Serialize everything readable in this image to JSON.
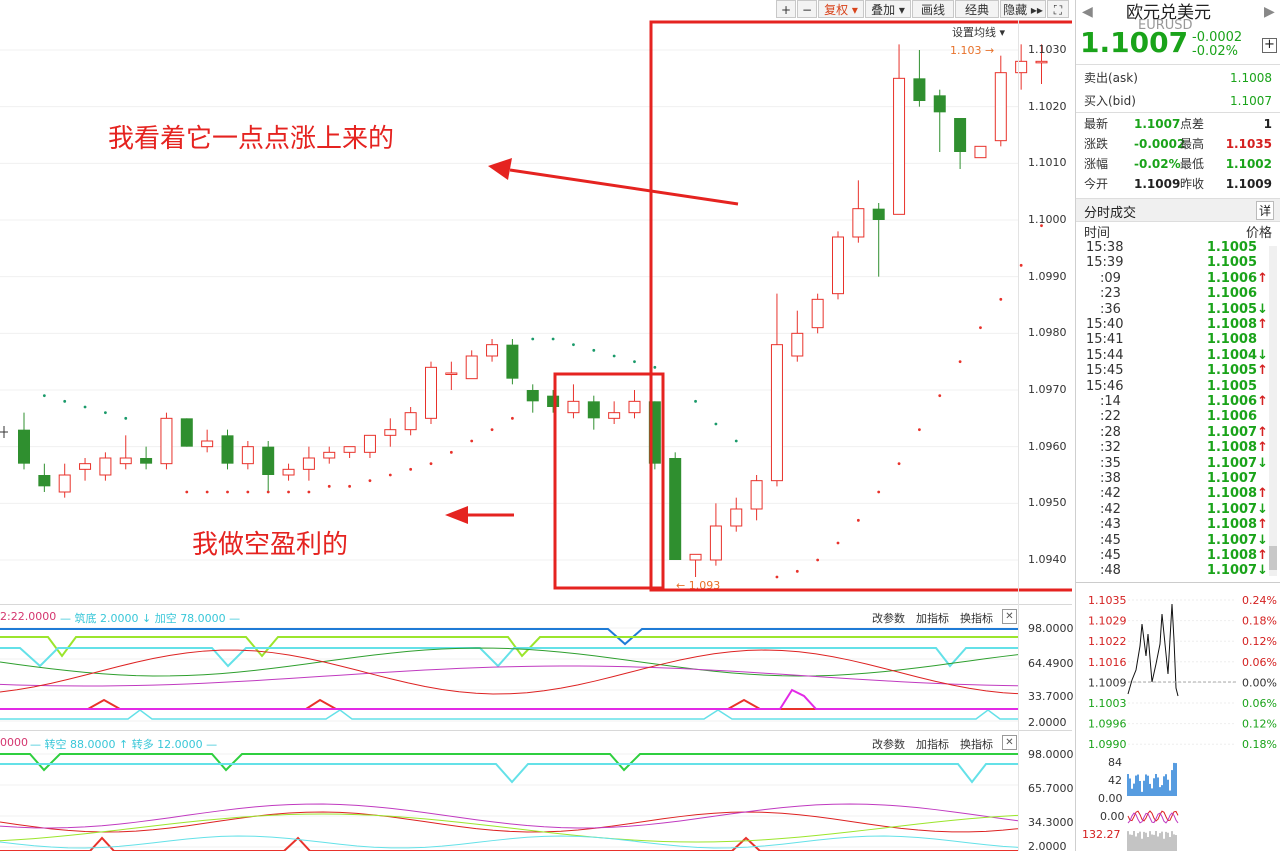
{
  "toolbar": {
    "plus": "+",
    "minus": "−",
    "fuquan": "复权 ▾",
    "diejia": "叠加 ▾",
    "huaxian": "画线",
    "jingdian": "经典",
    "yincang": "隐藏 ▸▸",
    "expand": "⛶"
  },
  "chart": {
    "ma_setting": "设置均线 ▾",
    "price_labels": [
      "1.1030",
      "1.1020",
      "1.1010",
      "1.1000",
      "1.0990",
      "1.0980",
      "1.0970",
      "1.0960",
      "1.0950",
      "1.0940"
    ],
    "high_marker": "1.103",
    "low_marker": "1.093"
  },
  "annotations": {
    "top": "我看着它一点点涨上来的",
    "bottom": "我做空盈利的"
  },
  "indicator1": {
    "header_left": "2:22.0000",
    "header_mid": "— 筑底 2.0000 ↓ 加空 78.0000 —",
    "scale": [
      "98.0000",
      "64.4900",
      "33.7000",
      "2.0000"
    ],
    "btn_params": "改参数",
    "btn_add": "加指标",
    "btn_switch": "换指标",
    "btn_close": "✕"
  },
  "indicator2": {
    "header_left": "0000",
    "header_mid": "— 转空 88.0000 ↑ 转多 12.0000 —",
    "scale": [
      "98.0000",
      "65.7000",
      "34.3000",
      "2.0000"
    ],
    "btn_params": "改参数",
    "btn_add": "加指标",
    "btn_switch": "换指标",
    "btn_close": "✕"
  },
  "quote": {
    "name": "欧元兑美元",
    "code": "EURUSD",
    "last": "1.1007",
    "change": "-0.0002",
    "change_pct": "-0.02%",
    "ask_label": "卖出(ask)",
    "ask": "1.1008",
    "bid_label": "买入(bid)",
    "bid": "1.1007",
    "stats": [
      {
        "l1": "最新",
        "v1": "1.1007",
        "c1": "grn",
        "l2": "点差",
        "v2": "1",
        "c2": "blk"
      },
      {
        "l1": "涨跌",
        "v1": "-0.0002",
        "c1": "grn",
        "l2": "最高",
        "v2": "1.1035",
        "c2": "red"
      },
      {
        "l1": "涨幅",
        "v1": "-0.02%",
        "c1": "grn",
        "l2": "最低",
        "v2": "1.1002",
        "c2": "grn"
      },
      {
        "l1": "今开",
        "v1": "1.1009",
        "c1": "blk",
        "l2": "昨收",
        "v2": "1.1009",
        "c2": "blk"
      }
    ]
  },
  "trades": {
    "title": "分时成交",
    "detail": "详",
    "col_time": "时间",
    "col_price": "价格",
    "rows": [
      {
        "t": "15:38",
        "p": "1.1005",
        "d": ""
      },
      {
        "t": "15:39",
        "p": "1.1005",
        "d": ""
      },
      {
        "t": ":09",
        "p": "1.1006",
        "d": "↑"
      },
      {
        "t": ":23",
        "p": "1.1006",
        "d": ""
      },
      {
        "t": ":36",
        "p": "1.1005",
        "d": "↓"
      },
      {
        "t": "15:40",
        "p": "1.1008",
        "d": "↑"
      },
      {
        "t": "15:41",
        "p": "1.1008",
        "d": ""
      },
      {
        "t": "15:44",
        "p": "1.1004",
        "d": "↓"
      },
      {
        "t": "15:45",
        "p": "1.1005",
        "d": "↑"
      },
      {
        "t": "15:46",
        "p": "1.1005",
        "d": ""
      },
      {
        "t": ":14",
        "p": "1.1006",
        "d": "↑"
      },
      {
        "t": ":22",
        "p": "1.1006",
        "d": ""
      },
      {
        "t": ":28",
        "p": "1.1007",
        "d": "↑"
      },
      {
        "t": ":32",
        "p": "1.1008",
        "d": "↑"
      },
      {
        "t": ":35",
        "p": "1.1007",
        "d": "↓"
      },
      {
        "t": ":38",
        "p": "1.1007",
        "d": ""
      },
      {
        "t": ":42",
        "p": "1.1008",
        "d": "↑"
      },
      {
        "t": ":42",
        "p": "1.1007",
        "d": "↓"
      },
      {
        "t": ":43",
        "p": "1.1008",
        "d": "↑"
      },
      {
        "t": ":45",
        "p": "1.1007",
        "d": "↓"
      },
      {
        "t": ":45",
        "p": "1.1008",
        "d": "↑"
      },
      {
        "t": ":48",
        "p": "1.1007",
        "d": "↓"
      }
    ]
  },
  "mini": {
    "price_left": [
      "1.1035",
      "1.1029",
      "1.1022",
      "1.1016",
      "1.1009",
      "1.1003",
      "1.0996",
      "1.0990"
    ],
    "pct_right": [
      "0.24%",
      "0.18%",
      "0.12%",
      "0.06%",
      "0.00%",
      "0.06%",
      "0.12%",
      "0.18%"
    ],
    "vol_labels": [
      "84",
      "42",
      "0.00"
    ],
    "ind_labels": [
      "0.00",
      "132.27"
    ]
  },
  "colors": {
    "up": "#e8322b",
    "down": "#2f8f2f",
    "box": "#e52320",
    "sar": "#e8322b"
  },
  "candles": [
    {
      "o": 1.0963,
      "h": 1.0966,
      "l": 1.0956,
      "c": 1.0957
    },
    {
      "o": 1.0955,
      "h": 1.0957,
      "l": 1.0952,
      "c": 1.0953
    },
    {
      "o": 1.0952,
      "h": 1.0957,
      "l": 1.0951,
      "c": 1.0955
    },
    {
      "o": 1.0956,
      "h": 1.0958,
      "l": 1.0954,
      "c": 1.0957
    },
    {
      "o": 1.0955,
      "h": 1.0959,
      "l": 1.0954,
      "c": 1.0958
    },
    {
      "o": 1.0957,
      "h": 1.0962,
      "l": 1.0956,
      "c": 1.0958
    },
    {
      "o": 1.0958,
      "h": 1.096,
      "l": 1.0956,
      "c": 1.0957
    },
    {
      "o": 1.0957,
      "h": 1.0966,
      "l": 1.0956,
      "c": 1.0965
    },
    {
      "o": 1.0965,
      "h": 1.0965,
      "l": 1.096,
      "c": 1.096
    },
    {
      "o": 1.096,
      "h": 1.0963,
      "l": 1.0959,
      "c": 1.0961
    },
    {
      "o": 1.0962,
      "h": 1.0963,
      "l": 1.0956,
      "c": 1.0957
    },
    {
      "o": 1.0957,
      "h": 1.0961,
      "l": 1.0956,
      "c": 1.096
    },
    {
      "o": 1.096,
      "h": 1.0961,
      "l": 1.0952,
      "c": 1.0955
    },
    {
      "o": 1.0955,
      "h": 1.0957,
      "l": 1.0954,
      "c": 1.0956
    },
    {
      "o": 1.0956,
      "h": 1.096,
      "l": 1.0954,
      "c": 1.0958
    },
    {
      "o": 1.0958,
      "h": 1.096,
      "l": 1.0957,
      "c": 1.0959
    },
    {
      "o": 1.0959,
      "h": 1.096,
      "l": 1.0958,
      "c": 1.096
    },
    {
      "o": 1.0959,
      "h": 1.0962,
      "l": 1.0958,
      "c": 1.0962
    },
    {
      "o": 1.0962,
      "h": 1.0965,
      "l": 1.096,
      "c": 1.0963
    },
    {
      "o": 1.0963,
      "h": 1.0967,
      "l": 1.0962,
      "c": 1.0966
    },
    {
      "o": 1.0965,
      "h": 1.0975,
      "l": 1.0964,
      "c": 1.0974
    },
    {
      "o": 1.0973,
      "h": 1.0975,
      "l": 1.097,
      "c": 1.0973
    },
    {
      "o": 1.0972,
      "h": 1.0977,
      "l": 1.0972,
      "c": 1.0976
    },
    {
      "o": 1.0976,
      "h": 1.0979,
      "l": 1.0975,
      "c": 1.0978
    },
    {
      "o": 1.0978,
      "h": 1.0979,
      "l": 1.0971,
      "c": 1.0972
    },
    {
      "o": 1.097,
      "h": 1.0971,
      "l": 1.0966,
      "c": 1.0968
    },
    {
      "o": 1.0969,
      "h": 1.097,
      "l": 1.0966,
      "c": 1.0967
    },
    {
      "o": 1.0966,
      "h": 1.0971,
      "l": 1.0965,
      "c": 1.0968
    },
    {
      "o": 1.0968,
      "h": 1.0969,
      "l": 1.0963,
      "c": 1.0965
    },
    {
      "o": 1.0965,
      "h": 1.0968,
      "l": 1.0964,
      "c": 1.0966
    },
    {
      "o": 1.0966,
      "h": 1.097,
      "l": 1.0965,
      "c": 1.0968
    },
    {
      "o": 1.0968,
      "h": 1.0968,
      "l": 1.0956,
      "c": 1.0957
    },
    {
      "o": 1.0958,
      "h": 1.0959,
      "l": 1.094,
      "c": 1.094
    },
    {
      "o": 1.094,
      "h": 1.0941,
      "l": 1.0937,
      "c": 1.0941
    },
    {
      "o": 1.094,
      "h": 1.095,
      "l": 1.0939,
      "c": 1.0946
    },
    {
      "o": 1.0946,
      "h": 1.0951,
      "l": 1.0945,
      "c": 1.0949
    },
    {
      "o": 1.0949,
      "h": 1.0955,
      "l": 1.0947,
      "c": 1.0954
    },
    {
      "o": 1.0954,
      "h": 1.0987,
      "l": 1.0953,
      "c": 1.0978
    },
    {
      "o": 1.0976,
      "h": 1.0984,
      "l": 1.0975,
      "c": 1.098
    },
    {
      "o": 1.0981,
      "h": 1.0987,
      "l": 1.098,
      "c": 1.0986
    },
    {
      "o": 1.0987,
      "h": 1.0998,
      "l": 1.0986,
      "c": 1.0997
    },
    {
      "o": 1.0997,
      "h": 1.1007,
      "l": 1.0996,
      "c": 1.1002
    },
    {
      "o": 1.1002,
      "h": 1.1003,
      "l": 1.099,
      "c": 1.1
    },
    {
      "o": 1.1001,
      "h": 1.1031,
      "l": 1.1001,
      "c": 1.1025
    },
    {
      "o": 1.1025,
      "h": 1.103,
      "l": 1.102,
      "c": 1.1021
    },
    {
      "o": 1.1022,
      "h": 1.1023,
      "l": 1.1012,
      "c": 1.1019
    },
    {
      "o": 1.1018,
      "h": 1.1018,
      "l": 1.1009,
      "c": 1.1012
    },
    {
      "o": 1.1011,
      "h": 1.1013,
      "l": 1.1011,
      "c": 1.1013
    },
    {
      "o": 1.1014,
      "h": 1.1029,
      "l": 1.1013,
      "c": 1.1026
    },
    {
      "o": 1.1026,
      "h": 1.1031,
      "l": 1.1023,
      "c": 1.1028
    },
    {
      "o": 1.1028,
      "h": 1.1031,
      "l": 1.1024,
      "c": 1.1028
    }
  ],
  "sar": [
    {
      "i": 1,
      "v": 1.0969
    },
    {
      "i": 2,
      "v": 1.0968
    },
    {
      "i": 3,
      "v": 1.0967
    },
    {
      "i": 4,
      "v": 1.0966
    },
    {
      "i": 5,
      "v": 1.0965
    },
    {
      "i": 8,
      "v": 1.0952
    },
    {
      "i": 9,
      "v": 1.0952
    },
    {
      "i": 10,
      "v": 1.0952
    },
    {
      "i": 11,
      "v": 1.0952
    },
    {
      "i": 12,
      "v": 1.0952
    },
    {
      "i": 13,
      "v": 1.0952
    },
    {
      "i": 14,
      "v": 1.0952
    },
    {
      "i": 15,
      "v": 1.0953
    },
    {
      "i": 16,
      "v": 1.0953
    },
    {
      "i": 17,
      "v": 1.0954
    },
    {
      "i": 18,
      "v": 1.0955
    },
    {
      "i": 19,
      "v": 1.0956
    },
    {
      "i": 20,
      "v": 1.0957
    },
    {
      "i": 21,
      "v": 1.0959
    },
    {
      "i": 22,
      "v": 1.0961
    },
    {
      "i": 23,
      "v": 1.0963
    },
    {
      "i": 24,
      "v": 1.0965
    },
    {
      "i": 25,
      "v": 1.0979
    },
    {
      "i": 26,
      "v": 1.0979
    },
    {
      "i": 27,
      "v": 1.0978
    },
    {
      "i": 28,
      "v": 1.0977
    },
    {
      "i": 29,
      "v": 1.0976
    },
    {
      "i": 30,
      "v": 1.0975
    },
    {
      "i": 31,
      "v": 1.0974
    },
    {
      "i": 33,
      "v": 1.0968
    },
    {
      "i": 34,
      "v": 1.0964
    },
    {
      "i": 35,
      "v": 1.0961
    },
    {
      "i": 37,
      "v": 1.0937
    },
    {
      "i": 38,
      "v": 1.0938
    },
    {
      "i": 39,
      "v": 1.094
    },
    {
      "i": 40,
      "v": 1.0943
    },
    {
      "i": 41,
      "v": 1.0947
    },
    {
      "i": 42,
      "v": 1.0952
    },
    {
      "i": 43,
      "v": 1.0957
    },
    {
      "i": 44,
      "v": 1.0963
    },
    {
      "i": 45,
      "v": 1.0969
    },
    {
      "i": 46,
      "v": 1.0975
    },
    {
      "i": 47,
      "v": 1.0981
    },
    {
      "i": 48,
      "v": 1.0986
    },
    {
      "i": 49,
      "v": 1.0992
    },
    {
      "i": 50,
      "v": 1.0999
    }
  ]
}
